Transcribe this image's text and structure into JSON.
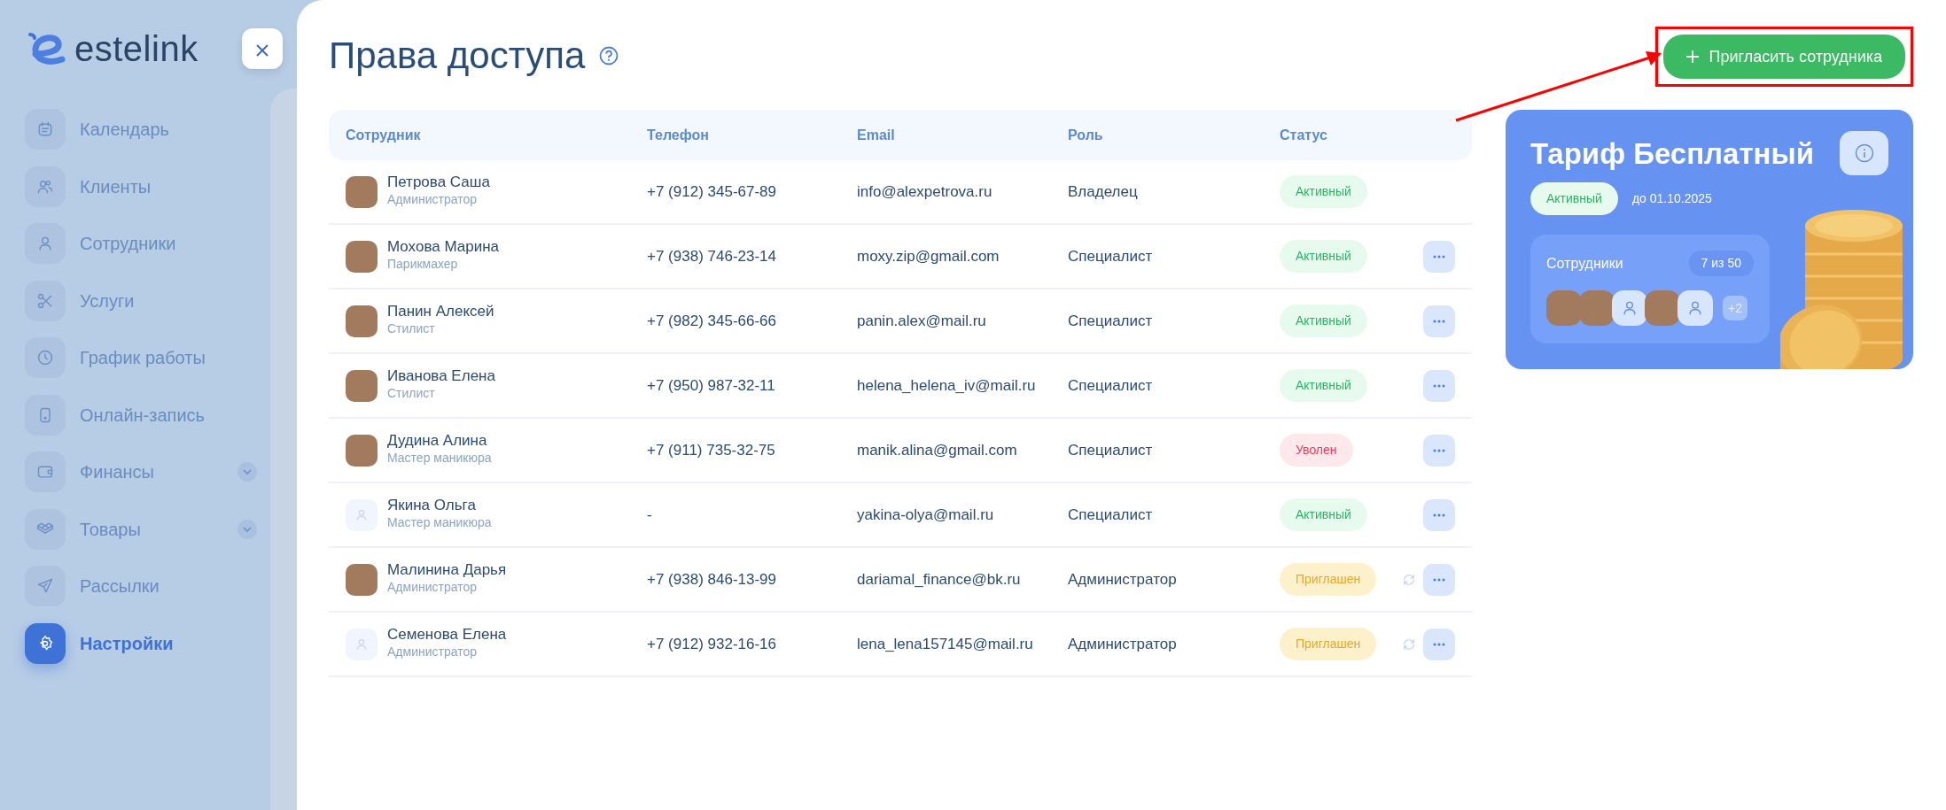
{
  "brand": {
    "name": "estelink"
  },
  "nav": [
    {
      "label": "Календарь",
      "selected": false,
      "expandable": false
    },
    {
      "label": "Клиенты",
      "selected": false,
      "expandable": false
    },
    {
      "label": "Сотрудники",
      "selected": false,
      "expandable": false
    },
    {
      "label": "Услуги",
      "selected": false,
      "expandable": false
    },
    {
      "label": "График работы",
      "selected": false,
      "expandable": false
    },
    {
      "label": "Онлайн-запись",
      "selected": false,
      "expandable": false
    },
    {
      "label": "Финансы",
      "selected": false,
      "expandable": true
    },
    {
      "label": "Товары",
      "selected": false,
      "expandable": true
    },
    {
      "label": "Рассылки",
      "selected": false,
      "expandable": false
    },
    {
      "label": "Настройки",
      "selected": true,
      "expandable": false
    }
  ],
  "page": {
    "title": "Права доступа",
    "invite_button": "Пригласить сотрудника"
  },
  "table": {
    "columns": [
      "Сотрудник",
      "Телефон",
      "Email",
      "Роль",
      "Статус"
    ],
    "rows": [
      {
        "kind": "photo",
        "name": "Петрова Саша",
        "position": "Администратор",
        "phone": "+7 (912) 345-67-89",
        "email": "info@alexpetrova.ru",
        "role": "Владелец",
        "status": {
          "text": "Активный",
          "kind": "active"
        },
        "menu": false
      },
      {
        "kind": "photo",
        "name": "Мохова Марина",
        "position": "Парикмахер",
        "phone": "+7 (938) 746-23-14",
        "email": "moxy.zip@gmail.com",
        "role": "Специалист",
        "status": {
          "text": "Активный",
          "kind": "active"
        },
        "menu": true
      },
      {
        "kind": "photo",
        "name": "Панин Алексей",
        "position": "Стилист",
        "phone": "+7 (982) 345-66-66",
        "email": "panin.alex@mail.ru",
        "role": "Специалист",
        "status": {
          "text": "Активный",
          "kind": "active"
        },
        "menu": true
      },
      {
        "kind": "photo",
        "name": "Иванова Елена",
        "position": "Стилист",
        "phone": "+7 (950) 987-32-11",
        "email": "helena_helena_iv@mail.ru",
        "role": "Специалист",
        "status": {
          "text": "Активный",
          "kind": "active"
        },
        "menu": true
      },
      {
        "kind": "photo",
        "name": "Дудина Алина",
        "position": "Мастер маникюра",
        "phone": "+7 (911) 735-32-75",
        "email": "manik.alina@gmail.com",
        "role": "Специалист",
        "status": {
          "text": "Уволен",
          "kind": "fired"
        },
        "menu": true
      },
      {
        "kind": "placeholder",
        "name": "Якина Ольга",
        "position": "Мастер маникюра",
        "phone": "-",
        "email": "yakina-olya@mail.ru",
        "role": "Специалист",
        "status": {
          "text": "Активный",
          "kind": "active"
        },
        "menu": true
      },
      {
        "kind": "photo",
        "name": "Малинина Дарья",
        "position": "Администратор",
        "phone": "+7 (938) 846-13-99",
        "email": "dariamal_finance@bk.ru",
        "role": "Администратор",
        "status": {
          "text": "Приглашен",
          "kind": "invited"
        },
        "menu": true
      },
      {
        "kind": "placeholder",
        "name": "Семенова Елена",
        "position": "Администратор",
        "phone": "+7 (912) 932-16-16",
        "email": "lena_lena157145@mail.ru",
        "role": "Администратор",
        "status": {
          "text": "Приглашен",
          "kind": "invited"
        },
        "menu": true
      }
    ]
  },
  "tariff": {
    "title": "Тариф Бесплатный",
    "status": "Активный",
    "until": "до 01.10.2025",
    "staff_label": "Сотрудники",
    "staff_count": "7 из 50",
    "avatars": [
      {
        "kind": "photo"
      },
      {
        "kind": "photo"
      },
      {
        "kind": "placeholder"
      },
      {
        "kind": "photo"
      },
      {
        "kind": "placeholder"
      }
    ],
    "more": "+2"
  }
}
